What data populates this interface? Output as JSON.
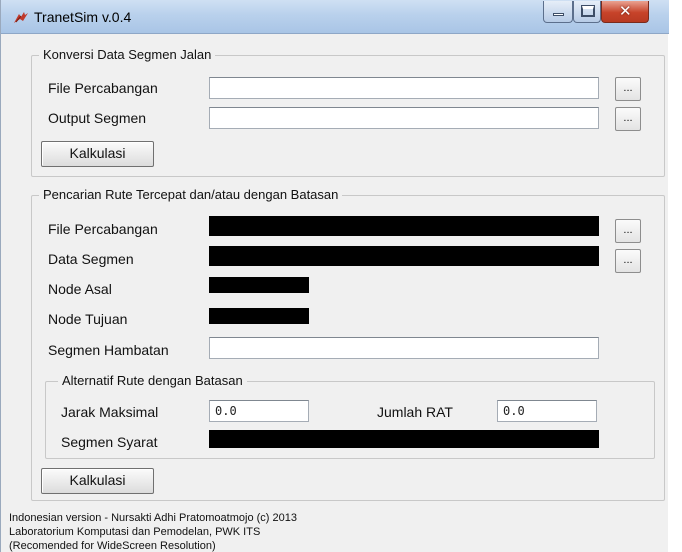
{
  "window": {
    "title": "TranetSim v.0.4",
    "controls": {
      "minimize": "–",
      "maximize": "□",
      "close": "✕"
    }
  },
  "konversi": {
    "legend": "Konversi Data Segmen Jalan",
    "file_percabangan_label": "File Percabangan",
    "output_segmen_label": "Output Segmen",
    "file_percabangan_value": "",
    "output_segmen_value": "",
    "browse_label": "...",
    "kalkulasi_label": "Kalkulasi"
  },
  "pencarian": {
    "legend": "Pencarian Rute Tercepat dan/atau dengan Batasan",
    "file_percabangan_label": "File Percabangan",
    "data_segmen_label": "Data Segmen",
    "node_asal_label": "Node Asal",
    "node_tujuan_label": "Node Tujuan",
    "segmen_hambatan_label": "Segmen Hambatan",
    "segmen_hambatan_value": "",
    "browse_label": "...",
    "alternatif": {
      "legend": "Alternatif Rute dengan Batasan",
      "jarak_maksimal_label": "Jarak Maksimal",
      "jarak_maksimal_value": "0.0",
      "jumlah_rat_label": "Jumlah RAT",
      "jumlah_rat_value": "0.0",
      "segmen_syarat_label": "Segmen Syarat"
    },
    "kalkulasi_label": "Kalkulasi"
  },
  "footer": {
    "line1": "Indonesian version - Nursakti Adhi Pratomoatmojo (c) 2013",
    "line2": "Laboratorium Komputasi dan Pemodelan, PWK ITS",
    "line3": "(Recomended for WideScreen Resolution)"
  },
  "colors": {
    "titlebar": "#b9d1ec",
    "window_bg": "#f0f0f0",
    "close_button": "#c7432a",
    "filled_field": "#000000"
  },
  "icons": [
    "tk-feather-icon",
    "minimize-icon",
    "maximize-icon",
    "close-icon"
  ]
}
